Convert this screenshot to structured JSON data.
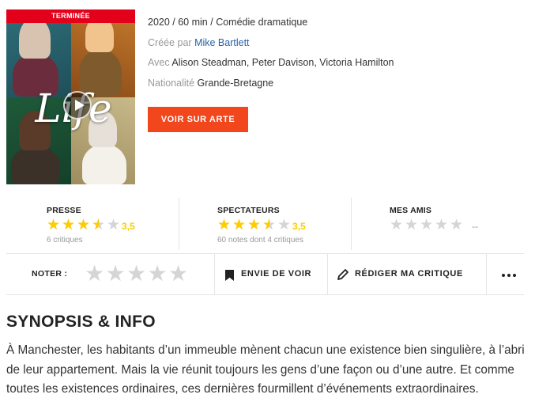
{
  "poster": {
    "badge": "TERMINÉE",
    "title_art": "Life",
    "play_icon": "play-icon"
  },
  "meta": {
    "year": "2020",
    "sep1": " / ",
    "duration": "60 min",
    "sep2": " / ",
    "genre": "Comédie dramatique",
    "created_label": "Créée par ",
    "creator": "Mike Bartlett",
    "cast_label": "Avec ",
    "cast": "Alison Steadman, Peter Davison, Victoria Hamilton",
    "nationality_label": "Nationalité ",
    "nationality": "Grande-Bretagne"
  },
  "cta": {
    "label": "VOIR SUR ARTE",
    "color": "#f2461c"
  },
  "ratings": [
    {
      "label": "PRESSE",
      "value": 3.5,
      "value_text": "3,5",
      "sub": "6 critiques"
    },
    {
      "label": "SPECTATEURS",
      "value": 3.5,
      "value_text": "3,5",
      "sub": "60 notes dont 4 critiques"
    },
    {
      "label": "MES AMIS",
      "value": 0,
      "value_text": "--",
      "sub": ""
    }
  ],
  "star_color": "#fecc00",
  "actions": {
    "noter_label": "NOTER :",
    "envie_label": "ENVIE DE VOIR",
    "critique_label": "RÉDIGER MA CRITIQUE",
    "more_icon": "more-dots-icon"
  },
  "synopsis": {
    "title": "SYNOPSIS & INFO",
    "text": "À Manchester, les habitants d’un immeuble mènent chacun une existence bien singulière, à l’abri de leur appartement. Mais la vie réunit toujours les gens d’une façon ou d’une autre. Et comme toutes les existences ordinaires, ces dernières fourmillent d’événements extraordinaires."
  }
}
